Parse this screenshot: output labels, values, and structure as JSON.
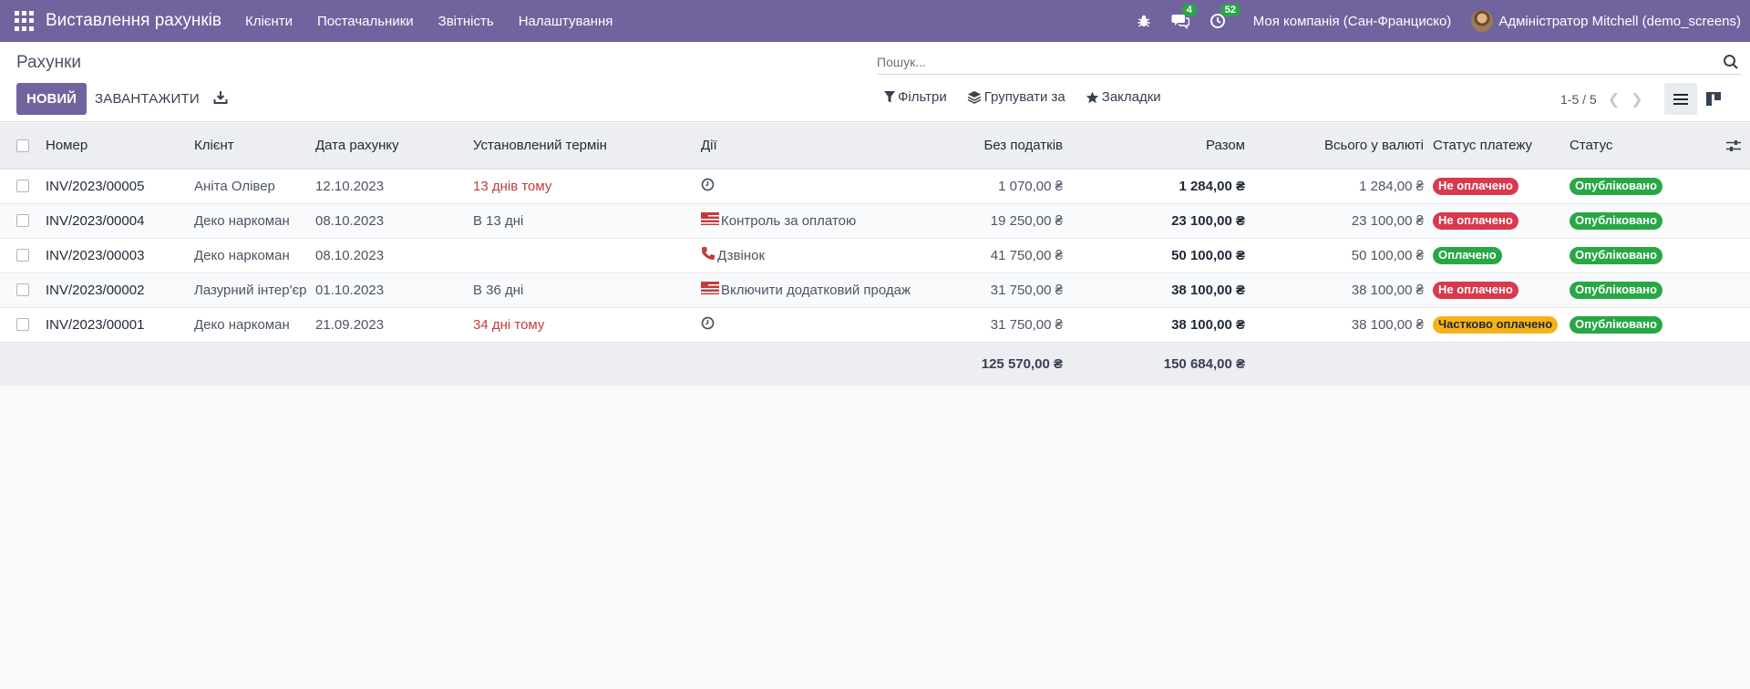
{
  "navbar": {
    "app_title": "Виставлення рахунків",
    "menu": [
      "Клієнти",
      "Постачальники",
      "Звітність",
      "Налаштування"
    ],
    "messages_count": "4",
    "activities_count": "52",
    "company": "Моя компанія (Сан-Франциско)",
    "user": "Адміністратор Mitchell (demo_screens)"
  },
  "control_panel": {
    "breadcrumb": "Рахунки",
    "search_placeholder": "Пошук...",
    "new_button": "НОВИЙ",
    "upload_button": "ЗАВАНТАЖИТИ",
    "filters": "Фільтри",
    "group_by": "Групувати за",
    "favorites": "Закладки",
    "pager": "1-5 / 5"
  },
  "table": {
    "columns": [
      "Номер",
      "Клієнт",
      "Дата рахунку",
      "Установлений термін",
      "Дії",
      "Без податків",
      "Разом",
      "Всього у валюті",
      "Статус платежу",
      "Статус"
    ],
    "rows": [
      {
        "number": "INV/2023/00005",
        "client": "Аніта Олівер",
        "date": "12.10.2023",
        "due": "13 днів тому",
        "due_overdue": true,
        "activity_icon": "clock-icon",
        "activity": "",
        "untaxed": "1 070,00 ₴",
        "total": "1 284,00 ₴",
        "total_currency": "1 284,00 ₴",
        "payment_status": "Не оплачено",
        "payment_color": "red",
        "status": "Опубліковано"
      },
      {
        "number": "INV/2023/00004",
        "client": "Деко наркоман",
        "date": "08.10.2023",
        "due": "В 13 дні",
        "due_overdue": false,
        "activity_icon": "flag-icon",
        "activity": "Контроль за оплатою",
        "untaxed": "19 250,00 ₴",
        "total": "23 100,00 ₴",
        "total_currency": "23 100,00 ₴",
        "payment_status": "Не оплачено",
        "payment_color": "red",
        "status": "Опубліковано"
      },
      {
        "number": "INV/2023/00003",
        "client": "Деко наркоман",
        "date": "08.10.2023",
        "due": "",
        "due_overdue": false,
        "activity_icon": "phone-icon",
        "activity": "Дзвінок",
        "untaxed": "41 750,00 ₴",
        "total": "50 100,00 ₴",
        "total_currency": "50 100,00 ₴",
        "payment_status": "Оплачено",
        "payment_color": "green",
        "status": "Опубліковано"
      },
      {
        "number": "INV/2023/00002",
        "client": "Лазурний інтер'єр",
        "date": "01.10.2023",
        "due": "В 36 дні",
        "due_overdue": false,
        "activity_icon": "flag-icon",
        "activity": "Включити додатковий продаж",
        "untaxed": "31 750,00 ₴",
        "total": "38 100,00 ₴",
        "total_currency": "38 100,00 ₴",
        "payment_status": "Не оплачено",
        "payment_color": "red",
        "status": "Опубліковано"
      },
      {
        "number": "INV/2023/00001",
        "client": "Деко наркоман",
        "date": "21.09.2023",
        "due": "34 дні тому",
        "due_overdue": true,
        "activity_icon": "clock-icon",
        "activity": "",
        "untaxed": "31 750,00 ₴",
        "total": "38 100,00 ₴",
        "total_currency": "38 100,00 ₴",
        "payment_status": "Частково оплачено",
        "payment_color": "orange",
        "status": "Опубліковано"
      }
    ],
    "totals": {
      "untaxed": "125 570,00 ₴",
      "total": "150 684,00 ₴"
    }
  },
  "colors": {
    "brand": "#71639e",
    "danger": "#d9394d",
    "success": "#28a745",
    "warning": "#f6b21b"
  }
}
